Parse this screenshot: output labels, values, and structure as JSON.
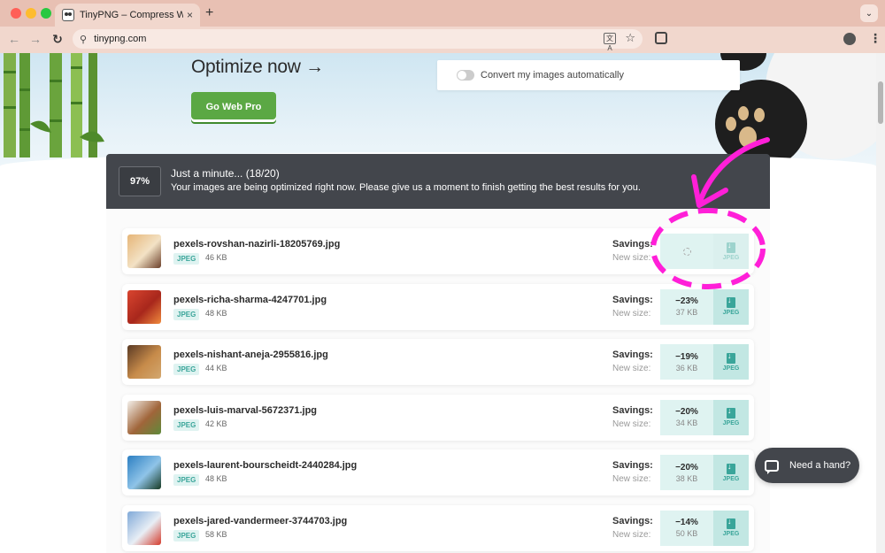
{
  "browser": {
    "tab_title": "TinyPNG – Compress WebP, PNG",
    "tab_close": "×",
    "new_tab": "+",
    "url": "tinypng.com",
    "back": "←",
    "forward": "→",
    "reload": "↻",
    "site_settings": "⚲",
    "star": "☆",
    "translate": "文A",
    "menu": "⋮",
    "tab_menu": "⌄"
  },
  "hero": {
    "title": "Optimize now →",
    "cta": "Go Web Pro",
    "convert_label": "Convert my images automatically",
    "convert_enabled": false
  },
  "progress": {
    "percent": "97%",
    "title": "Just a minute...   (18/20)",
    "message": "Your images are being optimized right now. Please give us a moment to finish getting the best results for you."
  },
  "labels": {
    "savings": "Savings:",
    "new_size": "New size:"
  },
  "files": [
    {
      "name": "pexels-rovshan-nazirli-18205769.jpg",
      "format": "JPEG",
      "size": "46 KB",
      "saving": "",
      "new_size": "",
      "status": "processing",
      "thumb": [
        "#e6b577",
        "#6b3f2a",
        "#f3e2c5"
      ]
    },
    {
      "name": "pexels-richa-sharma-4247701.jpg",
      "format": "JPEG",
      "size": "48 KB",
      "saving": "−23%",
      "new_size": "37 KB",
      "status": "done",
      "thumb": [
        "#d9452f",
        "#f08a3d",
        "#a8271c"
      ]
    },
    {
      "name": "pexels-nishant-aneja-2955816.jpg",
      "format": "JPEG",
      "size": "44 KB",
      "saving": "−19%",
      "new_size": "36 KB",
      "status": "done",
      "thumb": [
        "#5a3a24",
        "#d3a870",
        "#c78b4a"
      ]
    },
    {
      "name": "pexels-luis-marval-5672371.jpg",
      "format": "JPEG",
      "size": "42 KB",
      "saving": "−20%",
      "new_size": "34 KB",
      "status": "done",
      "thumb": [
        "#f4f1ec",
        "#5f8a3a",
        "#a0653a"
      ]
    },
    {
      "name": "pexels-laurent-bourscheidt-2440284.jpg",
      "format": "JPEG",
      "size": "48 KB",
      "saving": "−20%",
      "new_size": "38 KB",
      "status": "done",
      "thumb": [
        "#2c7fc2",
        "#173a23",
        "#8fc4e8"
      ]
    },
    {
      "name": "pexels-jared-vandermeer-3744703.jpg",
      "format": "JPEG",
      "size": "58 KB",
      "saving": "−14%",
      "new_size": "50 KB",
      "status": "done",
      "thumb": [
        "#7fa9d8",
        "#d43b2c",
        "#e8eef5"
      ]
    }
  ],
  "download_label": "JPEG",
  "help": {
    "label": "Need a hand?"
  },
  "colors": {
    "accent_green": "#5ba844",
    "teal": "#3aa59a",
    "panel_dark": "#43464c",
    "annotation_magenta": "#ff1fd8"
  }
}
